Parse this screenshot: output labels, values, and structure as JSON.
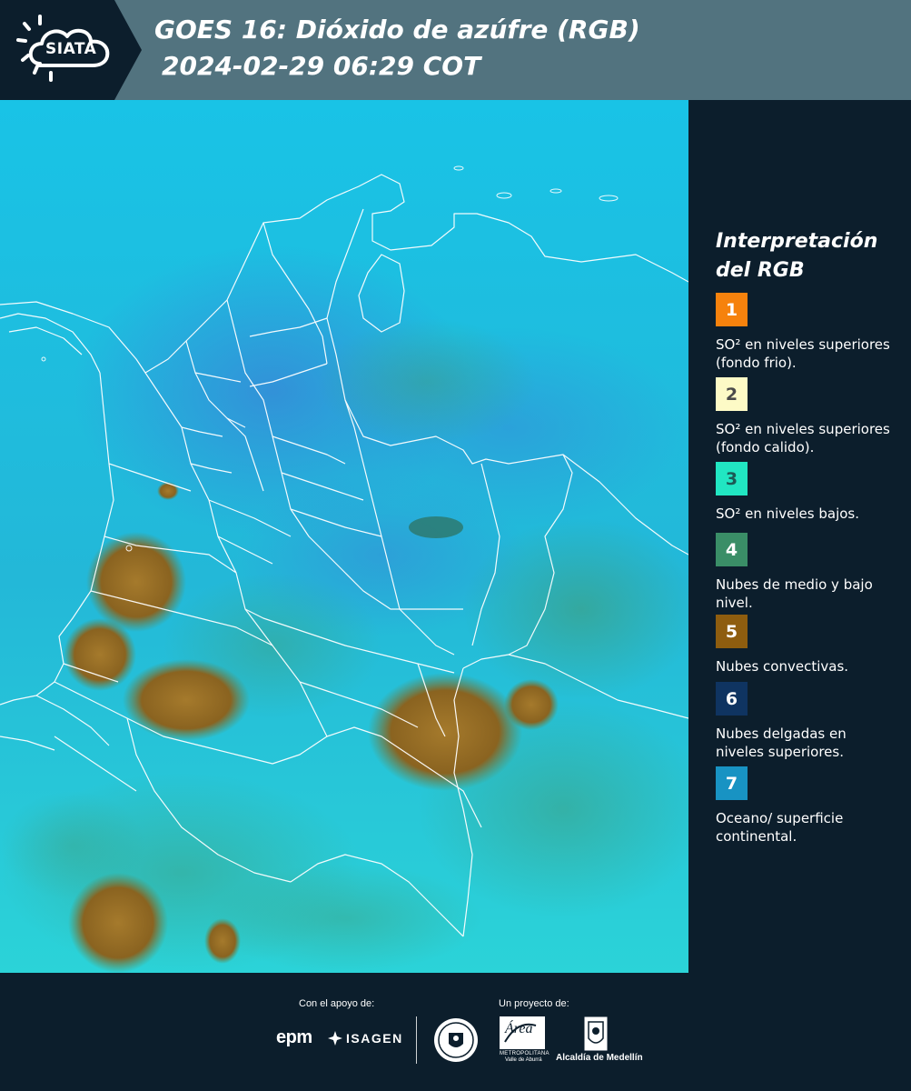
{
  "header": {
    "logo_text": "SIATA",
    "title_line1": "GOES 16: Dióxido de azúfre (RGB)",
    "title_line2": "2024-02-29 06:29 COT"
  },
  "legend": {
    "title_line1": "Interpretación",
    "title_line2": "del RGB",
    "items": [
      {
        "number": "1",
        "color": "#f6820d",
        "text_color": "#ffffff",
        "label": "SO² en niveles superiores (fondo frio)."
      },
      {
        "number": "2",
        "color": "#fdfac6",
        "text_color": "#4a4a4a",
        "label": "SO² en niveles superiores (fondo calido)."
      },
      {
        "number": "3",
        "color": "#21e6c2",
        "text_color": "#1c5a55",
        "label": "SO² en niveles bajos."
      },
      {
        "number": "4",
        "color": "#3a8e67",
        "text_color": "#ffffff",
        "label": "Nubes de medio y bajo nivel."
      },
      {
        "number": "5",
        "color": "#8e5d0f",
        "text_color": "#ffffff",
        "label": "Nubes convectivas."
      },
      {
        "number": "6",
        "color": "#0f3461",
        "text_color": "#ffffff",
        "label": "Nubes delgadas en niveles superiores."
      },
      {
        "number": "7",
        "color": "#1893c3",
        "text_color": "#ffffff",
        "label": "Oceano/ superficie continental."
      }
    ]
  },
  "footer": {
    "support_caption": "Con el apoyo de:",
    "project_caption": "Un proyecto de:",
    "epm": "epm",
    "isagen": "ISAGEN",
    "area_word": "Área",
    "area_sub1": "METROPOLITANA",
    "area_sub2": "Valle de Aburrá",
    "alcaldia": "Alcaldía de Medellín"
  },
  "colors": {
    "header_bg": "#52737f",
    "panel_bg": "#0c1e2c",
    "ocean": "#19bde0",
    "convective": "#8e6a1e",
    "midlow": "#3a9a7a"
  },
  "icons": [
    "siata-sun-cloud-icon",
    "medellin-seal-icon",
    "area-metropolitana-icon",
    "alcaldia-shield-icon",
    "isagen-icon"
  ]
}
